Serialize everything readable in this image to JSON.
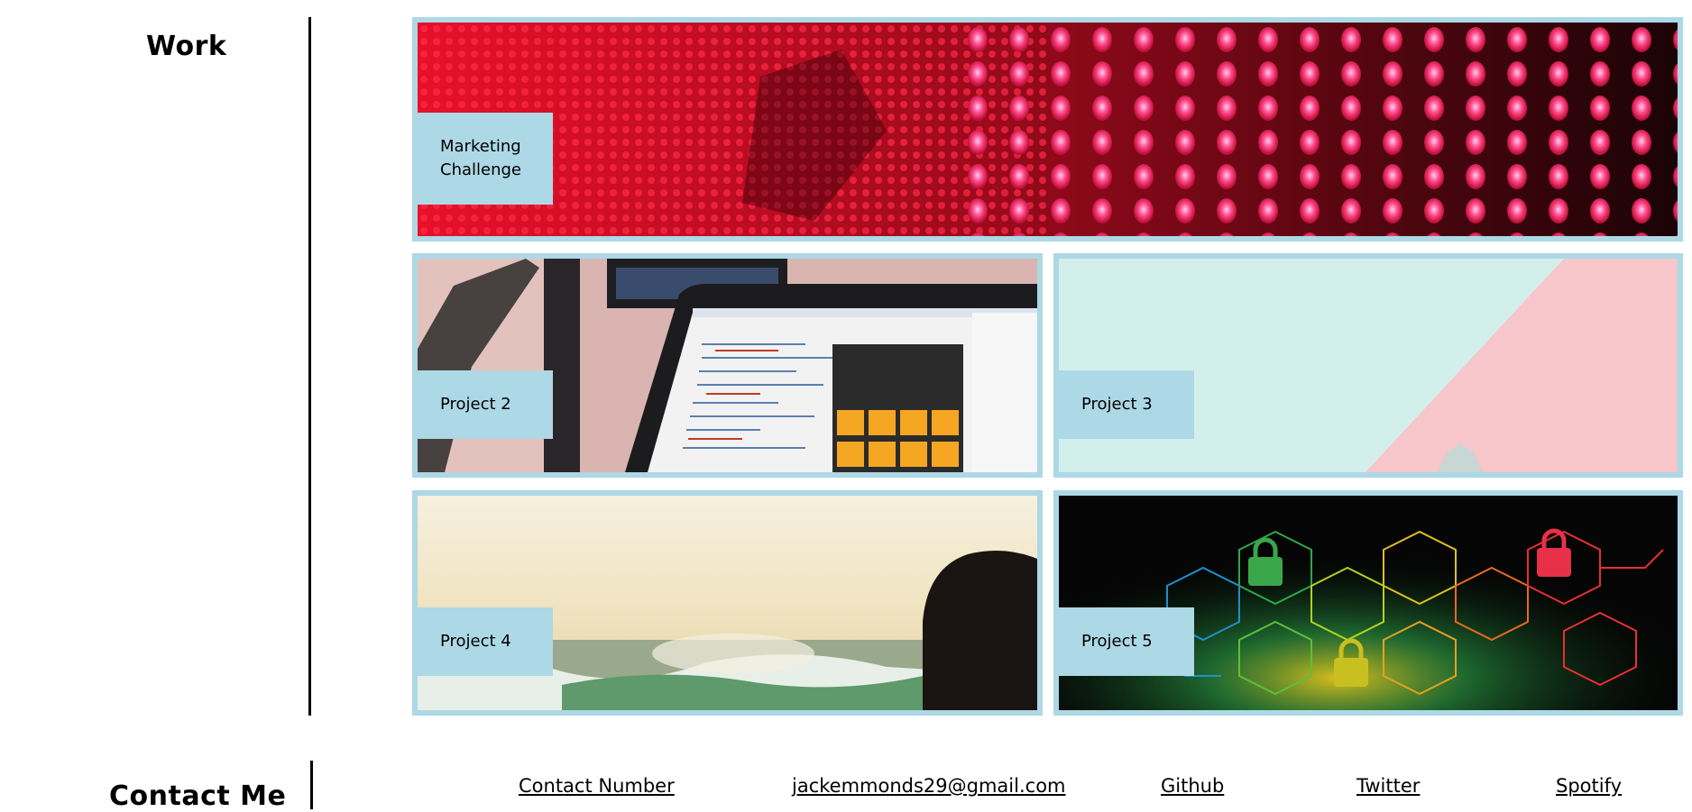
{
  "work": {
    "heading": "Work",
    "projects": [
      {
        "label": "Marketing Challenge",
        "line1": "Marketing",
        "line2": "Challenge",
        "image": "red led wall"
      },
      {
        "label": "Project 2",
        "image": "laptop with code and calculator"
      },
      {
        "label": "Project 3",
        "image": "mint and pink pastel"
      },
      {
        "label": "Project 4",
        "image": "ocean waves at sunset"
      },
      {
        "label": "Project 5",
        "image": "circuit hexagons with padlocks"
      }
    ]
  },
  "contact": {
    "heading": "Contact Me",
    "links": [
      {
        "label": "Contact Number"
      },
      {
        "label": "jackemmonds29@gmail.com"
      },
      {
        "label": "Github"
      },
      {
        "label": "Twitter"
      },
      {
        "label": "Spotify"
      }
    ]
  },
  "colors": {
    "accent": "#add8e6",
    "text": "#000000",
    "background": "#ffffff"
  }
}
